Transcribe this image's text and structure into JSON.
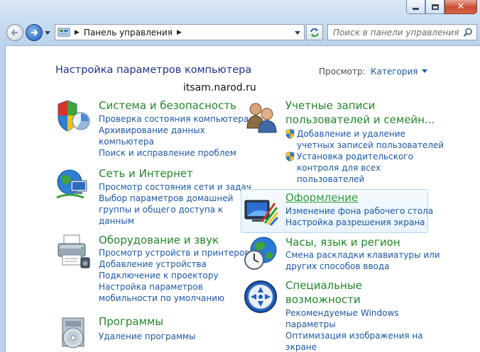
{
  "window": {
    "controls": {
      "minimize": "",
      "maximize": "",
      "close": "✕"
    }
  },
  "nav": {
    "breadcrumb": "Панель управления",
    "search_placeholder": "Поиск в панели управления"
  },
  "header": {
    "title": "Настройка параметров компьютера",
    "view_label": "Просмотр:",
    "view_value": "Категория",
    "watermark": "itsam.narod.ru"
  },
  "categories_left": [
    {
      "title": "Система и безопасность",
      "icon": "shield-security-icon",
      "links": [
        "Проверка состояния компьютера",
        "Архивирование данных",
        "компьютера",
        "Поиск и исправление проблем"
      ]
    },
    {
      "title": "Сеть и Интернет",
      "icon": "network-globe-icon",
      "links": [
        "Просмотр состояния сети и задач",
        "Выбор параметров домашней",
        "группы и общего доступа к",
        "данным"
      ]
    },
    {
      "title": "Оборудование и звук",
      "icon": "printer-hardware-icon",
      "links": [
        "Просмотр устройств и принтеров",
        "Добавление устройства",
        "Подключение к проектору",
        "Настройка параметров",
        "мобильности по умолчанию"
      ]
    },
    {
      "title": "Программы",
      "icon": "programs-disc-icon",
      "links": [
        "Удаление программы"
      ]
    }
  ],
  "categories_right": [
    {
      "title_line1": "Учетные записи",
      "title_line2": "пользователей и семейн...",
      "icon": "users-accounts-icon",
      "links": [
        "Добавление и удаление",
        "учетных записей пользователей",
        "Установка родительского",
        "контроля для всех",
        "пользователей"
      ]
    },
    {
      "title": "Оформление",
      "icon": "appearance-display-icon",
      "links": [
        "Изменение фона рабочего стола",
        "Настройка разрешения экрана"
      ]
    },
    {
      "title": "Часы, язык и регион",
      "icon": "clock-globe-icon",
      "links": [
        "Смена раскладки клавиатуры или",
        "других способов ввода"
      ]
    },
    {
      "title_line1": "Специальные",
      "title_line2": "возможности",
      "icon": "accessibility-icon",
      "links": [
        "Рекомендуемые Windows",
        "параметры",
        "Оптимизация изображения на",
        "экране"
      ]
    }
  ],
  "colors": {
    "category_title": "#25852b",
    "link": "#1c58a3",
    "page_title": "#1e3287"
  }
}
